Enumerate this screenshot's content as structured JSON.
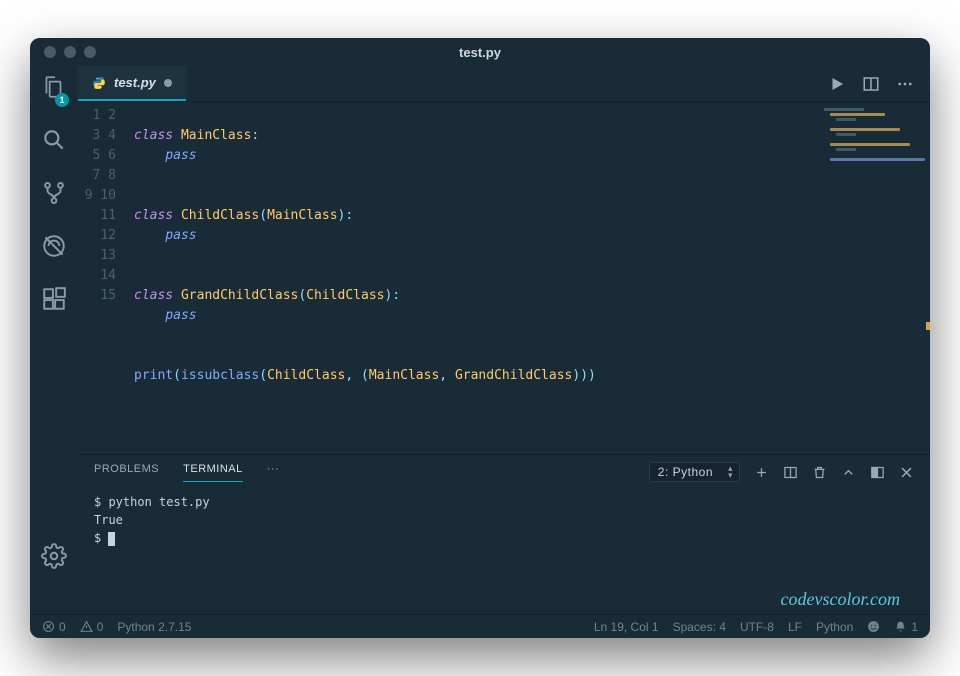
{
  "window": {
    "title": "test.py"
  },
  "activity": {
    "explorer_badge": "1"
  },
  "tab": {
    "filename": "test.py"
  },
  "code": {
    "lines": [
      "",
      "class MainClass:",
      "    pass",
      "",
      "",
      "class ChildClass(MainClass):",
      "    pass",
      "",
      "",
      "class GrandChildClass(ChildClass):",
      "    pass",
      "",
      "",
      "print(issubclass(ChildClass, (MainClass, GrandChildClass)))",
      ""
    ]
  },
  "panel": {
    "tabs": {
      "problems": "PROBLEMS",
      "terminal": "TERMINAL",
      "more": "···"
    },
    "terminal_select": "2: Python",
    "terminal_lines": [
      "$ python test.py",
      "True",
      "$ "
    ]
  },
  "status": {
    "errors": "0",
    "warnings": "0",
    "python_version": "Python 2.7.15",
    "position": "Ln 19, Col 1",
    "spaces": "Spaces: 4",
    "encoding": "UTF-8",
    "eol": "LF",
    "language": "Python",
    "bell": "1"
  },
  "watermark": "codevscolor.com"
}
